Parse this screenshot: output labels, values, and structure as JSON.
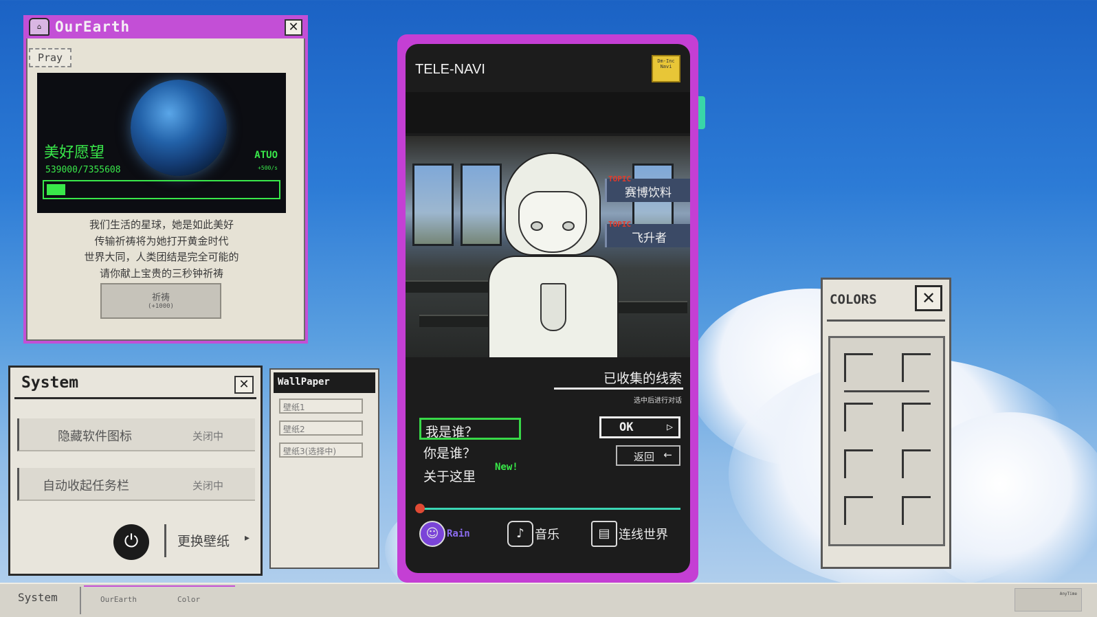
{
  "earth": {
    "title": "OurEarth",
    "home_icon": "home-icon",
    "close": "✕",
    "tab": "Pray",
    "wish": "美好愿望",
    "count": "539000/7355608",
    "mode": "ATUO",
    "rate": "+500/s",
    "progress": 0.08,
    "desc": [
      "我们生活的星球，她是如此美好",
      "传输祈祷将为她打开黄金时代",
      "世界大同，人类团结是完全可能的",
      "请你献上宝贵的三秒钟祈祷"
    ],
    "pray_button": "祈祷",
    "pray_bonus": "(+1000)"
  },
  "system": {
    "title": "System",
    "close": "✕",
    "rows": [
      {
        "label": "隐藏软件图标",
        "status": "关闭中"
      },
      {
        "label": "自动收起任务栏",
        "status": "关闭中"
      }
    ],
    "power_icon": "⏻",
    "change_wallpaper": "更换壁纸",
    "arrow": "▸"
  },
  "wallpaper": {
    "title": "WallPaper",
    "items": [
      "壁纸1",
      "壁纸2",
      "壁纸3(选择中)"
    ]
  },
  "tele": {
    "title": "TELE-NAVI",
    "badge": "Dm-Inc Navi",
    "topics": [
      {
        "tag": "TOPIC",
        "text": "赛博饮料"
      },
      {
        "tag": "TOPIC",
        "text": "飞升者"
      }
    ],
    "clues_title": "已收集的线索",
    "clues_hint": "选中后进行对话",
    "questions": [
      "我是谁？",
      "你是谁？",
      "关于这里"
    ],
    "new_tag": "New!",
    "ok": "OK",
    "ok_icon": "▷",
    "back": "返回",
    "back_icon": "←",
    "progress": 0.0,
    "nav": [
      {
        "icon": "rain-avatar-icon",
        "label": "Rain"
      },
      {
        "icon": "music-icon",
        "label": "音乐"
      },
      {
        "icon": "computer-icon",
        "label": "连线世界"
      }
    ]
  },
  "colors": {
    "title": "COLORS",
    "close": "✕"
  },
  "taskbar": {
    "system": "System",
    "tasks": [
      "OurEarth",
      "Color"
    ],
    "clock": "AnyTime"
  },
  "accent_colors": {
    "window_purple": "#c34fd6",
    "terminal_green": "#39e84a",
    "topic_red": "#e23a2a"
  }
}
